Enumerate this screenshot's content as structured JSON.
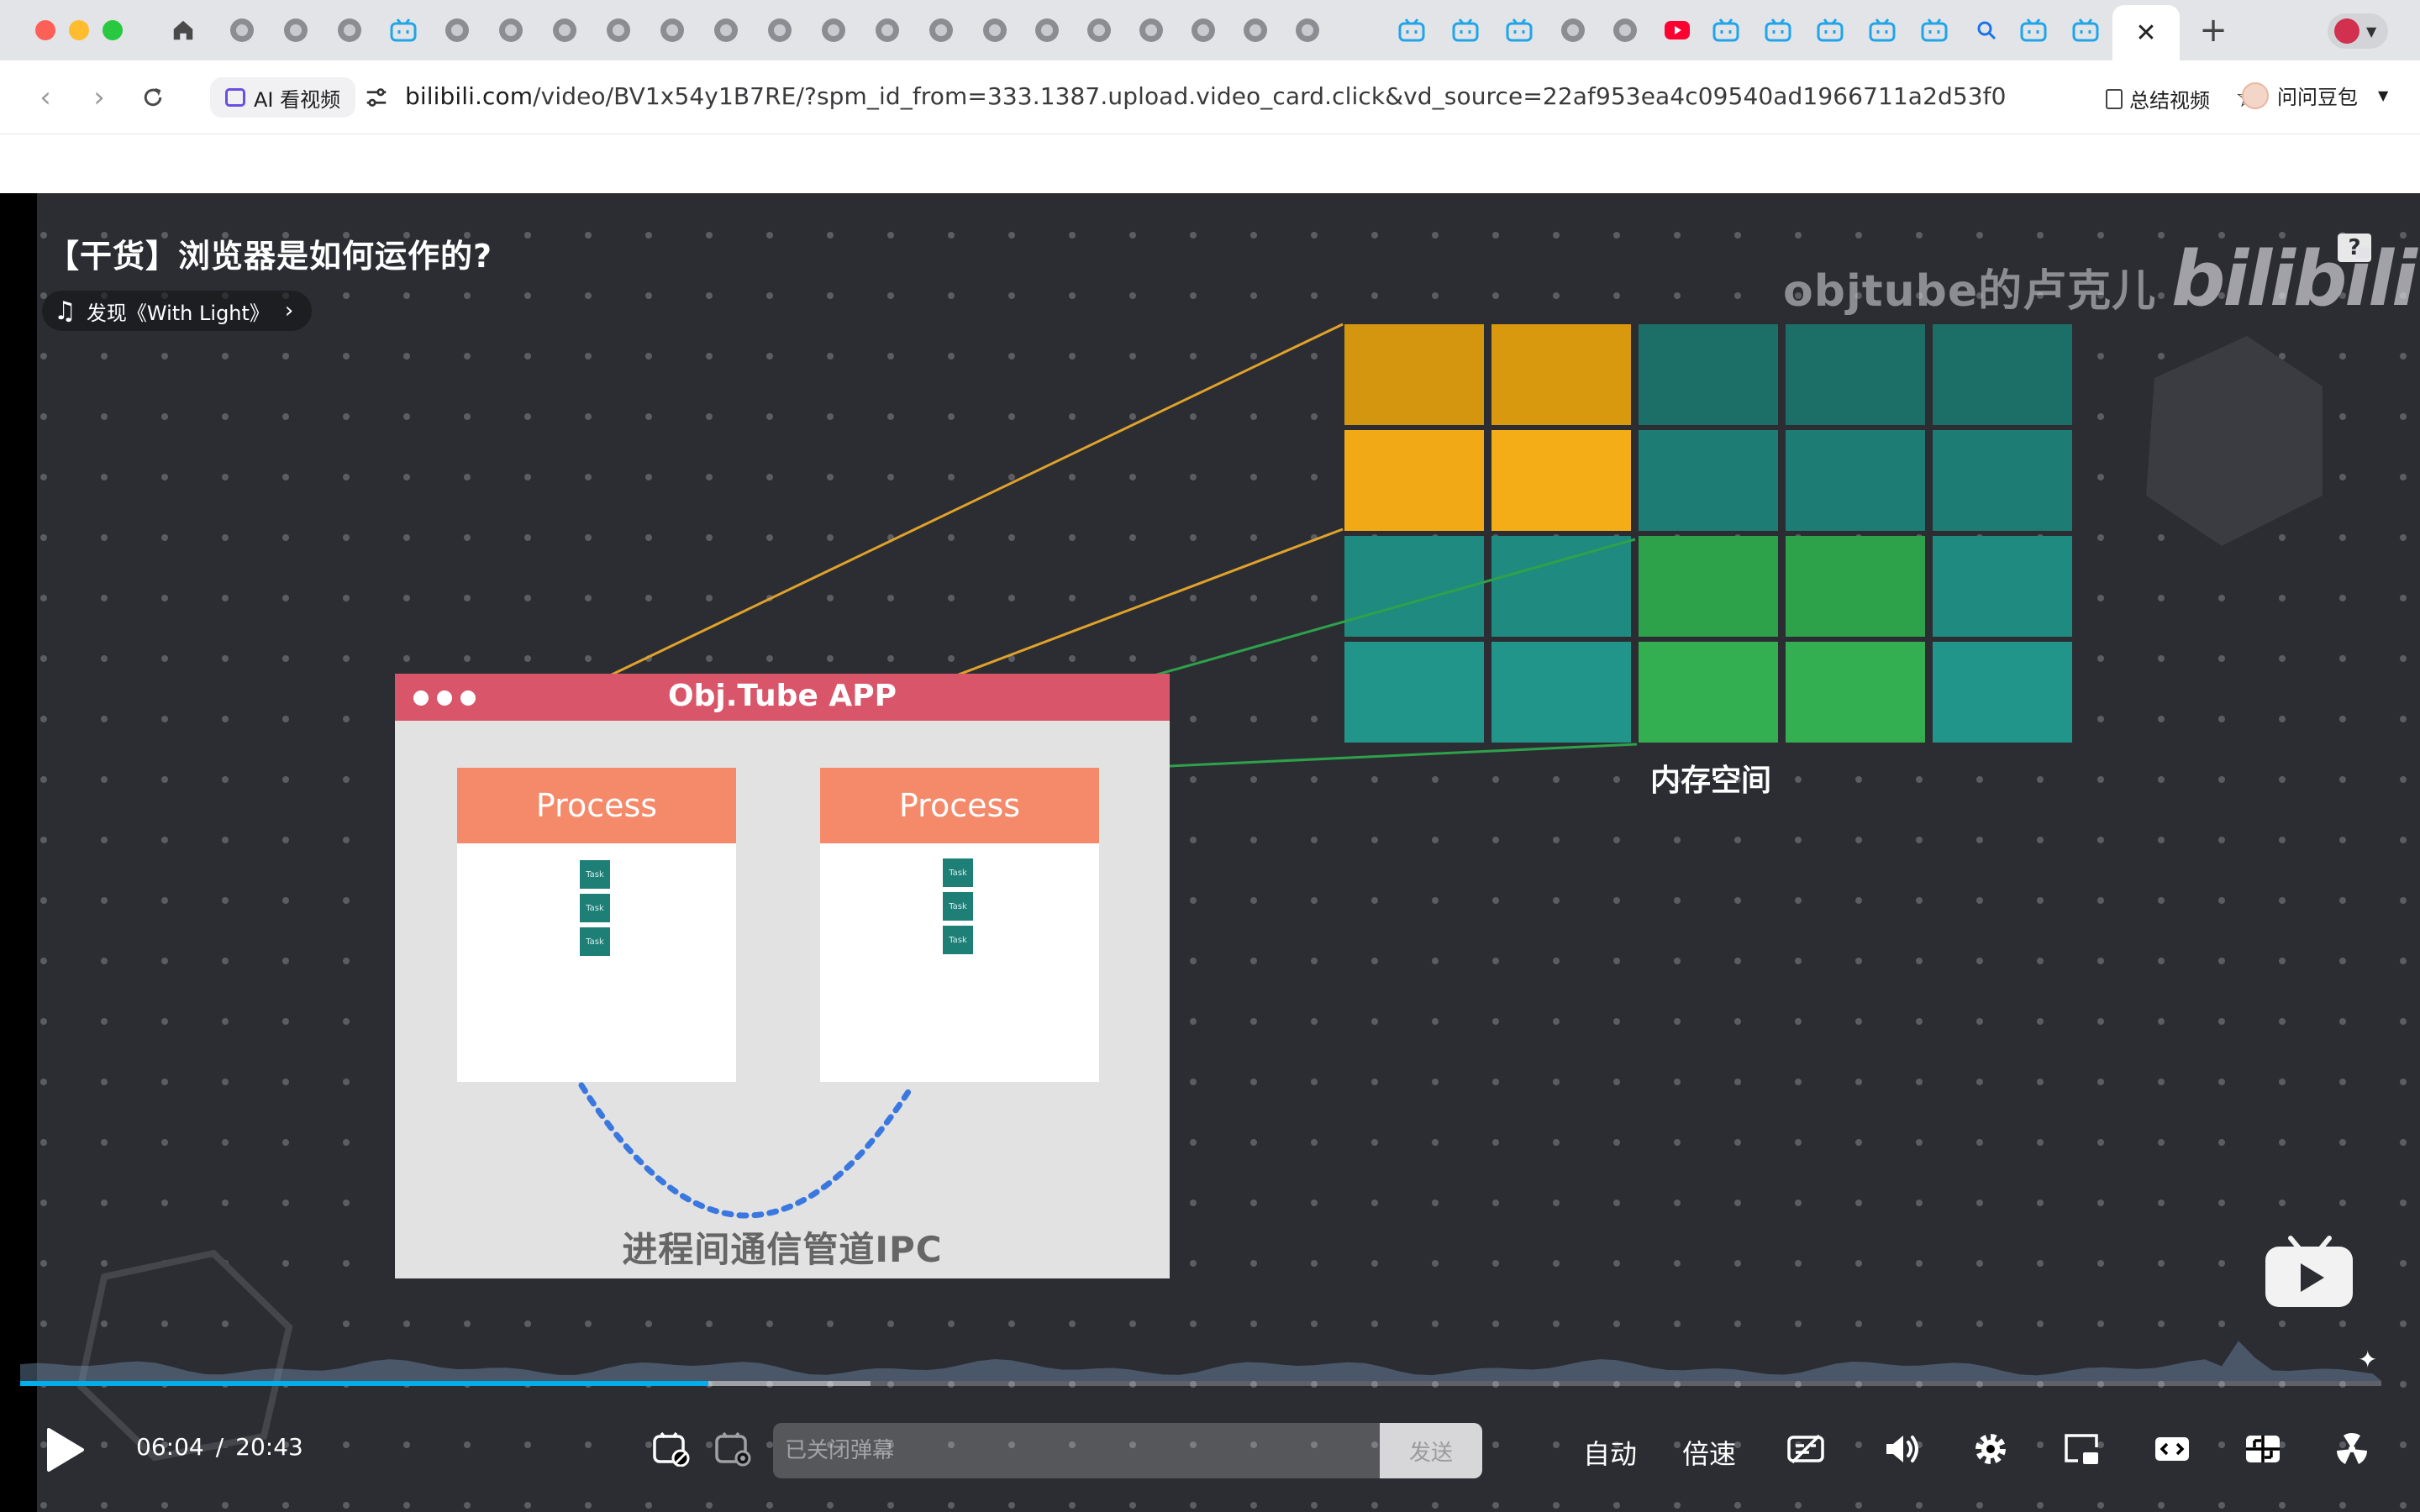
{
  "browser": {
    "active_tab_close": "✕",
    "new_tab": "+",
    "toolbar": {
      "ai_chip_label": "AI 看视频",
      "url_host": "bilibili.com",
      "url_path": "/video/BV1x54y1B7RE/?spm_id_from=333.1387.upload.video_card.click&vd_source=22af953ea4c09540ad1966711a2d53f0",
      "summary_label": "总结视频",
      "doubao_label": "问问豆包"
    }
  },
  "video": {
    "title": "【干货】浏览器是如何运作的?",
    "music_label": "发现《With Light》",
    "help_label": "?",
    "watermark_channel": "objtube的卢克儿",
    "watermark_logo": "bilibili",
    "memory_label": "内存空间",
    "app_title": "Obj.Tube APP",
    "process_label": "Process",
    "task_label": "Task",
    "ipc_label": "进程间通信管道IPC",
    "progress": {
      "played_fraction": 0.2915,
      "buffered_fraction": 0.36
    }
  },
  "controls": {
    "current_time": "06:04",
    "separator": "/",
    "duration": "20:43",
    "danmaku_placeholder": "已关闭弹幕",
    "send_label": "发送",
    "quality_label": "自动",
    "speed_label": "倍速"
  }
}
